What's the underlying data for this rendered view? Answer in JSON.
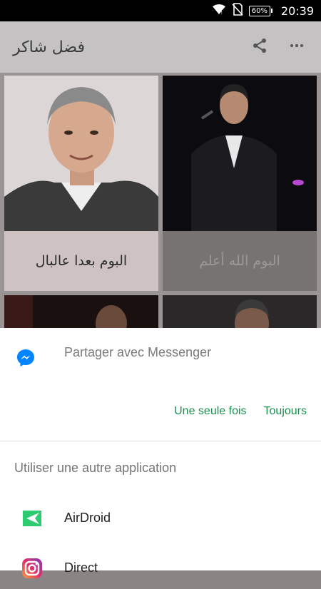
{
  "status_bar": {
    "time": "20:39",
    "battery": "60%",
    "icons": [
      "wifi-icon",
      "no-sim-icon",
      "battery-icon"
    ]
  },
  "app_bar": {
    "title": "فضل شاكر",
    "icons": [
      "share-icon",
      "more-vert-icon"
    ]
  },
  "albums": [
    {
      "title": "البوم بعدا عالبال"
    },
    {
      "title": "البوم الله أعلم"
    }
  ],
  "share_sheet": {
    "messenger_label": "Partager avec Messenger",
    "once_label": "Une seule fois",
    "always_label": "Toujours",
    "other_title": "Utiliser une autre application",
    "apps": [
      {
        "label": "AirDroid",
        "icon": "airdroid-icon"
      },
      {
        "label": "Direct",
        "icon": "instagram-icon"
      }
    ]
  },
  "colors": {
    "accent": "#1a8f4c",
    "messenger": "#0084ff",
    "airdroid": "#2ecc71"
  }
}
